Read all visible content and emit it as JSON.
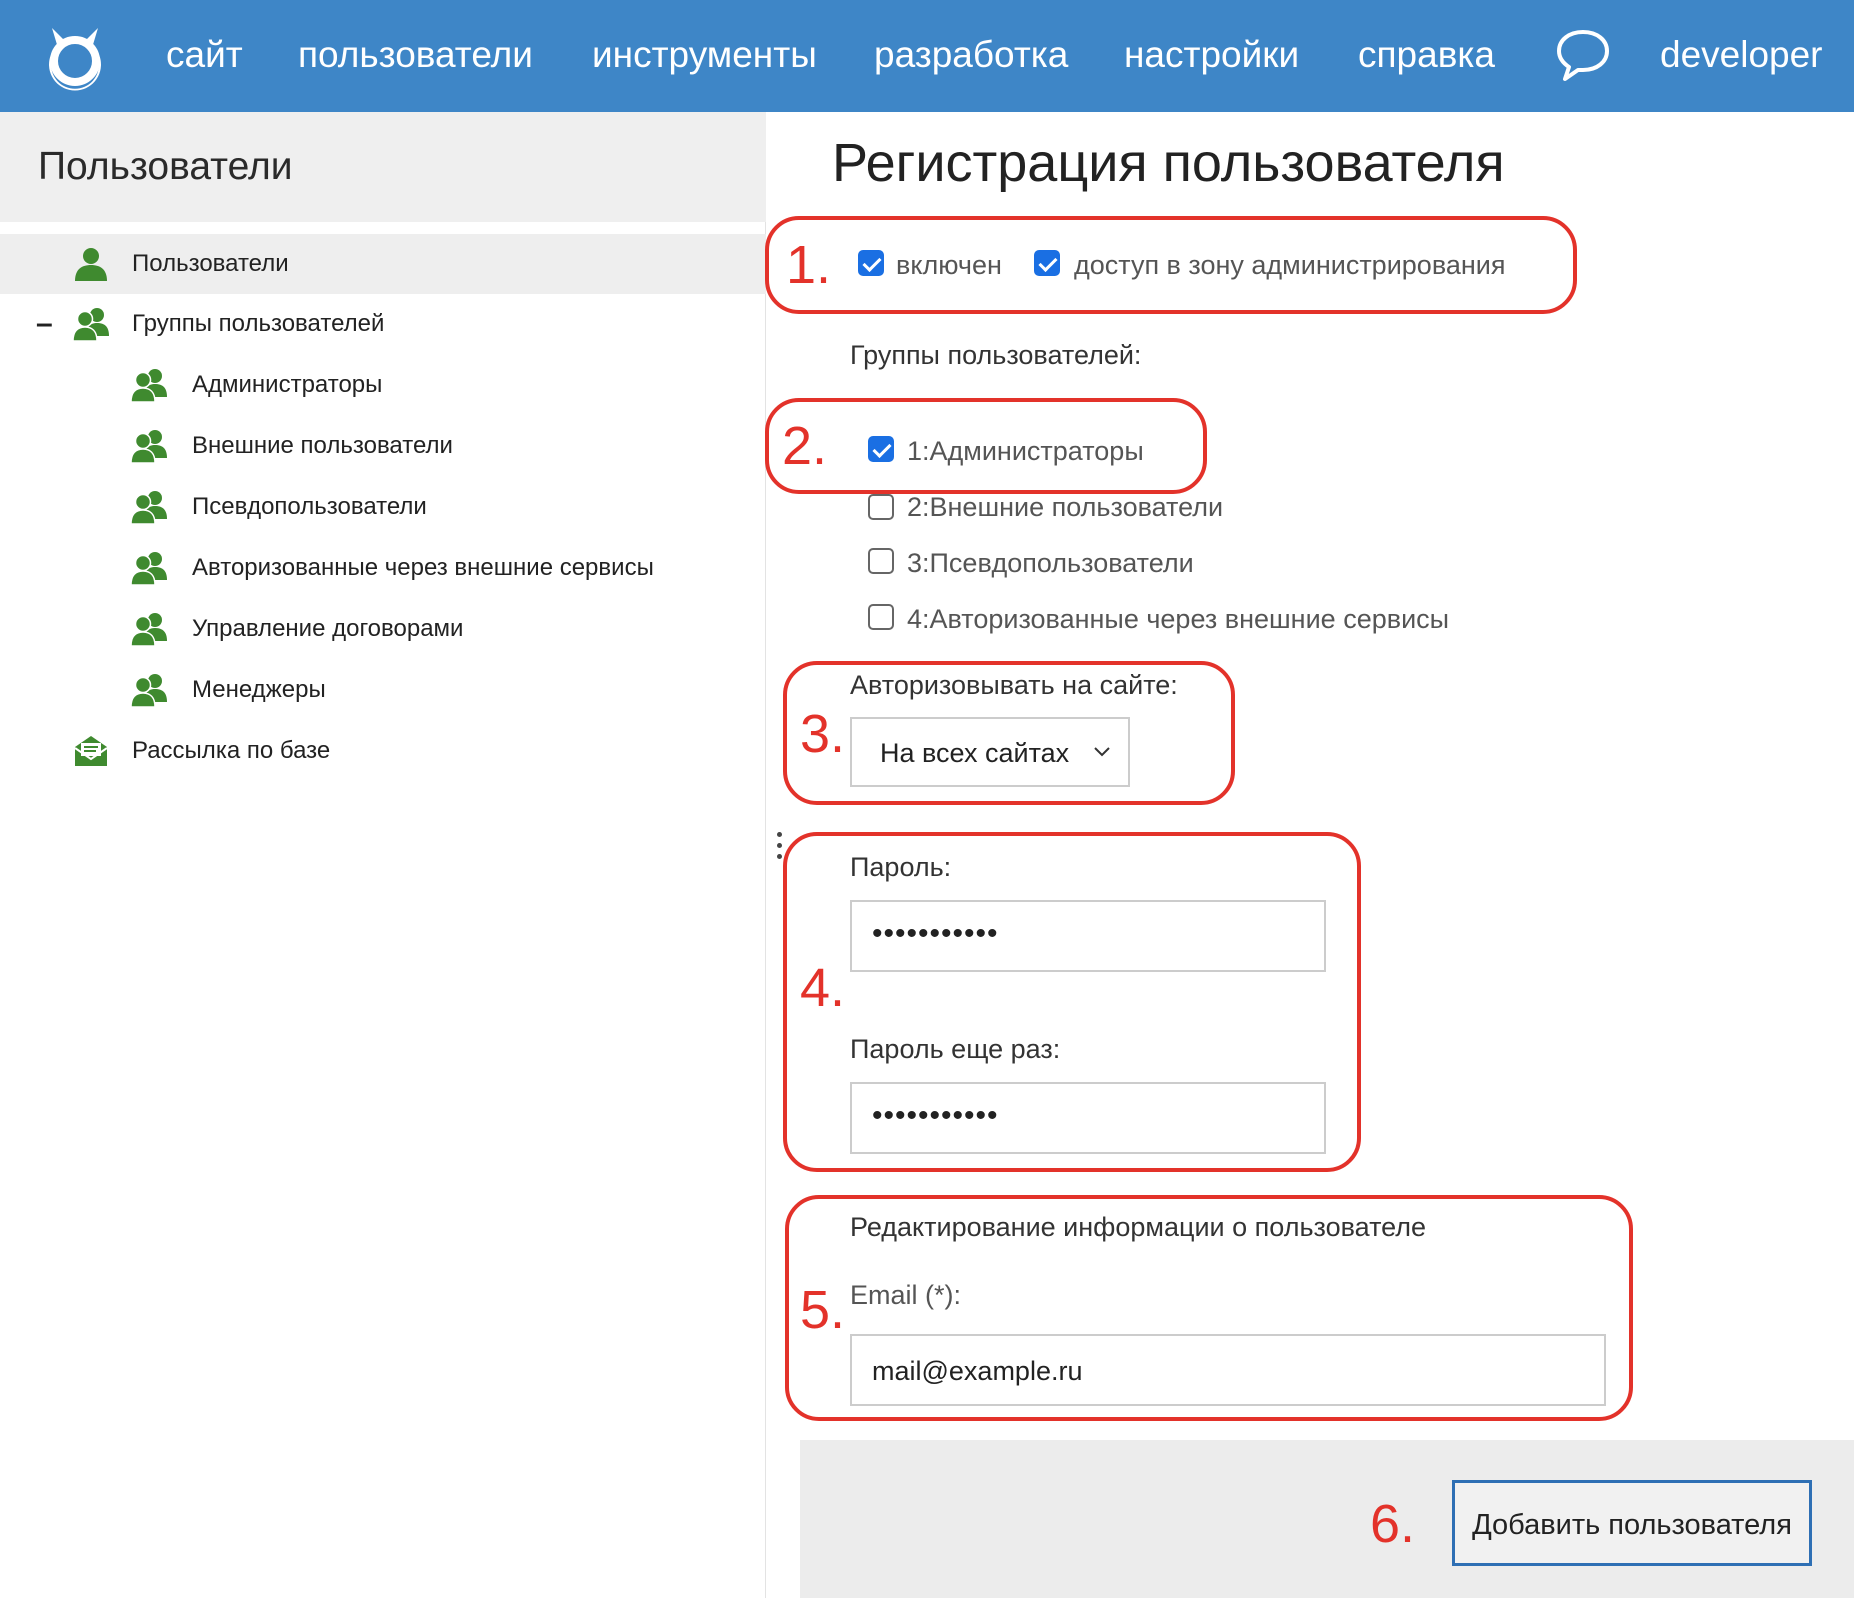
{
  "topbar": {
    "nav": [
      "сайт",
      "пользователи",
      "инструменты",
      "разработка",
      "настройки",
      "справка"
    ],
    "user": "developer"
  },
  "sidebar": {
    "title": "Пользователи",
    "items": [
      {
        "label": "Пользователи",
        "icon": "user-icon"
      },
      {
        "label": "Группы пользователей",
        "icon": "users-group-icon"
      },
      {
        "label": "Администраторы",
        "icon": "users-group-icon"
      },
      {
        "label": "Внешние пользователи",
        "icon": "users-group-icon"
      },
      {
        "label": "Псевдопользователи",
        "icon": "users-group-icon"
      },
      {
        "label": "Авторизованные через внешние сервисы",
        "icon": "users-group-icon"
      },
      {
        "label": "Управление договорами",
        "icon": "users-group-icon"
      },
      {
        "label": "Менеджеры",
        "icon": "users-group-icon"
      },
      {
        "label": "Рассылка по базе",
        "icon": "mail-icon"
      }
    ],
    "collapse_symbol": "–"
  },
  "form": {
    "title": "Регистрация пользователя",
    "enabled": {
      "label": "включен",
      "checked": true
    },
    "admin_access": {
      "label": "доступ в зону администрирования",
      "checked": true
    },
    "groups_label": "Группы пользователей:",
    "groups": [
      {
        "label": "1:Администраторы",
        "checked": true
      },
      {
        "label": "2:Внешние пользователи",
        "checked": false
      },
      {
        "label": "3:Псевдопользователи",
        "checked": false
      },
      {
        "label": "4:Авторизованные через внешние сервисы",
        "checked": false
      }
    ],
    "auth_label": "Авторизовывать на сайте:",
    "auth_value": "На всех сайтах",
    "password_label": "Пароль:",
    "password_value": "•••••••••••",
    "password_repeat_label": "Пароль еще раз:",
    "password_repeat_value": "•••••••••••",
    "section_label": "Редактирование информации о пользователе",
    "email_label": "Email (*):",
    "email_value": "mail@example.ru",
    "submit_label": "Добавить пользователя"
  },
  "annotations": [
    "1.",
    "2.",
    "3.",
    "4.",
    "5.",
    "6."
  ],
  "colors": {
    "topbar": "#3e86c7",
    "accent_checkbox": "#1a6fe3",
    "annotation": "#e3322a",
    "icon_green": "#3f8a2f",
    "button_border": "#2e6fb4"
  }
}
